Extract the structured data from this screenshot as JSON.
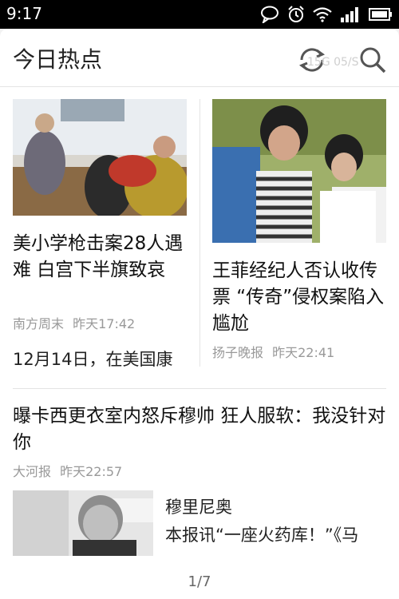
{
  "status_bar": {
    "time": "9:17",
    "icons": [
      "chat-bubble-icon",
      "alarm-icon",
      "wifi-icon",
      "signal-icon",
      "battery-icon"
    ]
  },
  "header": {
    "title": "今日热点",
    "overlay_text": "15G 05/S"
  },
  "articles": [
    {
      "headline": "美小学枪击案28人遇难 白宫下半旗致哀",
      "source": "南方周末",
      "time": "昨天17:42",
      "snippet": "12月14日，在美国康"
    },
    {
      "headline": "王菲经纪人否认收传票 “传奇”侵权案陷入尴尬",
      "source": "扬子晚报",
      "time": "昨天22:41"
    },
    {
      "headline": "曝卡西更衣室内怒斥穆帅 狂人服软：我没针对你",
      "source": "大河报",
      "time": "昨天22:57",
      "subtitle": "穆里尼奥",
      "snippet": "本报讯“一座火药库！”《马"
    }
  ],
  "pager": "1/7",
  "colors": {
    "status_bar": "#000000",
    "card": "#ffffff",
    "meta": "#999999",
    "divider": "#e4e4e4"
  }
}
